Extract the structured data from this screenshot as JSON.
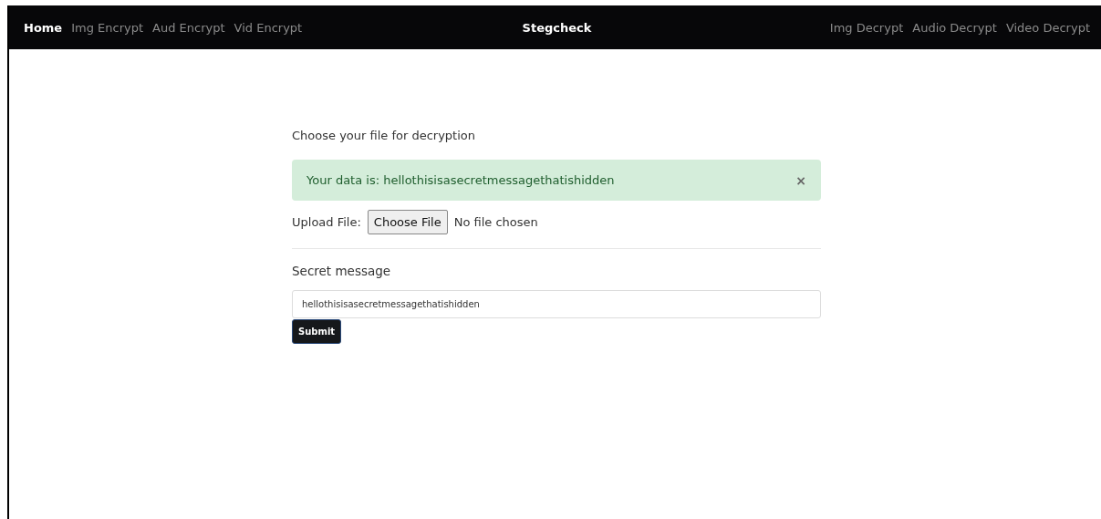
{
  "navbar": {
    "left_links": [
      {
        "label": "Home",
        "selected": true
      },
      {
        "label": "Img Encrypt",
        "selected": false
      },
      {
        "label": "Aud Encrypt",
        "selected": false
      },
      {
        "label": "Vid Encrypt",
        "selected": false
      }
    ],
    "brand": "Stegcheck",
    "right_links": [
      {
        "label": "Img Decrypt",
        "selected": false
      },
      {
        "label": "Audio Decrypt",
        "selected": false
      },
      {
        "label": "Video Decrypt",
        "selected": false
      }
    ]
  },
  "form": {
    "heading": "Choose your file for decryption",
    "alert": {
      "text": "Your data is: hellothisisasecretmessagethatishidden",
      "close": "×"
    },
    "upload": {
      "label": "Upload File:",
      "button": "Choose File",
      "status": "No file chosen"
    },
    "message_label": "Secret message",
    "message_value": "hellothisisasecretmessagethatishidden",
    "submit": "Submit"
  }
}
